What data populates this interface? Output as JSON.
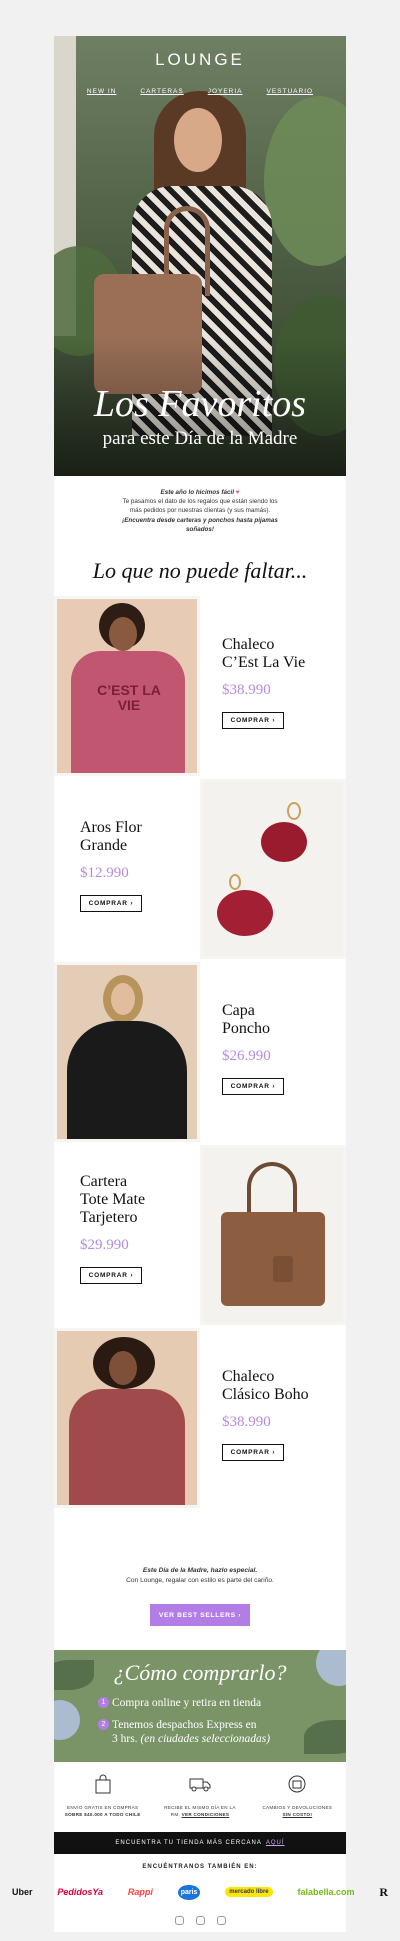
{
  "brand": {
    "logo": "LOUNGE"
  },
  "nav": [
    "NEW IN",
    "CARTERAS",
    "JOYERIA",
    "VESTUARIO"
  ],
  "hero": {
    "title": "Los Favoritos",
    "subtitle": "para este Día de la Madre"
  },
  "intro": {
    "line1": "Este año lo hicimos fácil",
    "heart": "♥",
    "line2": "Te pasamos el dato de los regalos que están siendo los",
    "line3": "más pedidos por nuestras clientas (y sus mamás).",
    "line4": "¡Encuentra desde carteras y ponchos hasta pijamas",
    "line5": "soñados!"
  },
  "section_title": "Lo que no puede faltar...",
  "products": [
    {
      "name_l1": "Chaleco",
      "name_l2": "C’Est La Vie",
      "name_l3": "",
      "price": "$38.990",
      "button": "COMPRAR ›",
      "image_text": "C’EST LA VIE"
    },
    {
      "name_l1": "Aros Flor",
      "name_l2": "Grande",
      "name_l3": "",
      "price": "$12.990",
      "button": "COMPRAR ›"
    },
    {
      "name_l1": "Capa",
      "name_l2": "Poncho",
      "name_l3": "",
      "price": "$26.990",
      "button": "COMPRAR ›"
    },
    {
      "name_l1": "Cartera",
      "name_l2": "Tote Mate",
      "name_l3": "Tarjetero",
      "price": "$29.990",
      "button": "COMPRAR ›"
    },
    {
      "name_l1": "Chaleco",
      "name_l2": "Clásico Boho",
      "name_l3": "",
      "price": "$38.990",
      "button": "COMPRAR ›"
    }
  ],
  "closing": {
    "line1": "Este Día de la Madre, hazlo especial.",
    "line2": "Con Lounge, regalar con estilo es parte del cariño.",
    "button": "VER BEST SELLERS ›"
  },
  "howto": {
    "title": "¿Cómo comprarlo?",
    "step1": "Compra online y retira en tienda",
    "step2_a": "Tenemos despachos Express en",
    "step2_b": "3 hrs.",
    "step2_c": "(en ciudades seleccionadas)"
  },
  "benefits": [
    {
      "icon": "shopping-bag-icon",
      "l1": "ENVÍO GRATIS EN COMPRAS",
      "l2": "SOBRE $40.000 A TODO CHILE",
      "link": ""
    },
    {
      "icon": "truck-icon",
      "l1": "RECIBE EL MISMO DÍA EN LA",
      "l2": "RM.",
      "link": "VER CONDICIONES"
    },
    {
      "icon": "return-box-icon",
      "l1": "CAMBIOS Y DEVOLUCIONES",
      "l2": "",
      "link": "SIN COSTO!"
    }
  ],
  "storebar": {
    "text": "ENCUENTRA TU TIENDA MÁS CERCANA",
    "link": "AQUÍ"
  },
  "found": "ENCUÉNTRANOS TAMBIÉN EN:",
  "partners": [
    "Uber",
    "PedidosYa",
    "Rappi",
    "paris",
    "mercado libre",
    "falabella.com",
    "R"
  ],
  "colors": {
    "accent": "#b27ee6",
    "price": "#b48be0",
    "green": "#7a9468"
  }
}
